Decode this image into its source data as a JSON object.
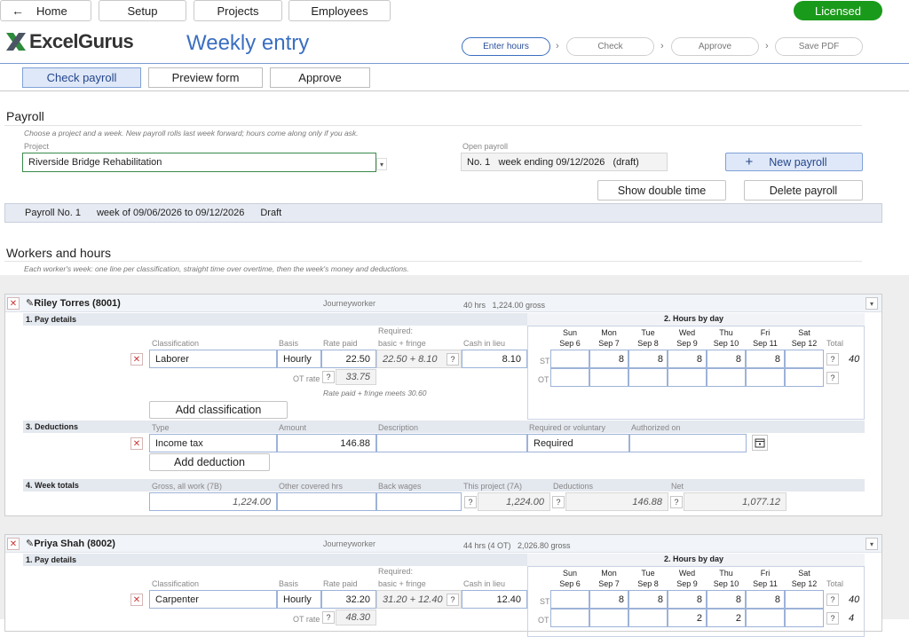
{
  "nav": {
    "home": "Home",
    "setup": "Setup",
    "projects": "Projects",
    "employees": "Employees",
    "license": "Licensed",
    "back_icon": "back-arrow-icon"
  },
  "brand": {
    "logo_text": "ExcelGurus",
    "page_title": "Weekly entry"
  },
  "steps": [
    "Enter hours",
    "Check",
    "Approve",
    "Save PDF"
  ],
  "subtabs": [
    "Check payroll",
    "Preview form",
    "Approve"
  ],
  "payroll": {
    "heading": "Payroll",
    "hint": "Choose a project and a week. New payroll rolls last week forward; hours come along only if you ask.",
    "project_label": "Project",
    "project_value": "Riverside Bridge Rehabilitation",
    "open_label": "Open payroll",
    "open_value": "No. 1   week ending 09/12/2026   (draft)",
    "new_button": "New payroll",
    "show_dt_button": "Show double time",
    "delete_button": "Delete payroll",
    "banner": {
      "number": "Payroll No. 1",
      "range": "week of 09/06/2026 to 09/12/2026",
      "status": "Draft"
    }
  },
  "workers_section": {
    "heading": "Workers and hours",
    "hint": "Each worker's week: one line per classification, straight time over overtime, then the week's money and deductions."
  },
  "labels": {
    "pay_details": "1. Pay details",
    "hours_by_day": "2. Hours by day",
    "deductions": "3. Deductions",
    "week_totals": "4. Week totals",
    "classification": "Classification",
    "basis": "Basis",
    "rate_paid": "Rate paid",
    "required_1": "Required:",
    "required_2": "basic + fringe",
    "cash_in_lieu": "Cash in lieu",
    "total": "Total",
    "st": "ST",
    "ot": "OT",
    "ot_rate": "OT rate",
    "add_classification": "Add classification",
    "add_deduction": "Add deduction",
    "type": "Type",
    "amount": "Amount",
    "description": "Description",
    "req_or_vol": "Required or voluntary",
    "authorized_on": "Authorized on",
    "gross_all": "Gross, all work (7B)",
    "other_hrs": "Other covered hrs",
    "back_wages": "Back wages",
    "this_project": "This project (7A)",
    "deductions_col": "Deductions",
    "net": "Net",
    "q": "?",
    "x": "✕"
  },
  "days": [
    {
      "d": "Sun",
      "date": "Sep 6"
    },
    {
      "d": "Mon",
      "date": "Sep 7"
    },
    {
      "d": "Tue",
      "date": "Sep 8"
    },
    {
      "d": "Wed",
      "date": "Sep 9"
    },
    {
      "d": "Thu",
      "date": "Sep 10"
    },
    {
      "d": "Fri",
      "date": "Sep 11"
    },
    {
      "d": "Sat",
      "date": "Sep 12"
    }
  ],
  "workers": [
    {
      "name": "Riley Torres (8001)",
      "role": "Journeyworker",
      "summary": "40 hrs   1,224.00 gross",
      "classification": "Laborer",
      "basis": "Hourly",
      "rate": "22.50",
      "required": "22.50 + 8.10",
      "cash": "8.10",
      "ot_rate": "33.75",
      "note": "Rate paid + fringe meets 30.60",
      "st": [
        "",
        "8",
        "8",
        "8",
        "8",
        "8",
        ""
      ],
      "ot": [
        "",
        "",
        "",
        "",
        "",
        "",
        ""
      ],
      "st_total": "40",
      "ot_total": "",
      "deduction": {
        "type": "Income tax",
        "amount": "146.88",
        "description": "",
        "required": "Required",
        "authorized": ""
      },
      "totals": {
        "gross": "1,224.00",
        "other": "",
        "back": "",
        "project": "1,224.00",
        "deductions": "146.88",
        "net": "1,077.12"
      }
    },
    {
      "name": "Priya Shah (8002)",
      "role": "Journeyworker",
      "summary": "44 hrs (4 OT)   2,026.80 gross",
      "classification": "Carpenter",
      "basis": "Hourly",
      "rate": "32.20",
      "required": "31.20 + 12.40",
      "cash": "12.40",
      "ot_rate": "48.30",
      "st": [
        "",
        "8",
        "8",
        "8",
        "8",
        "8",
        ""
      ],
      "ot": [
        "",
        "",
        "",
        "2",
        "2",
        "",
        ""
      ],
      "st_total": "40",
      "ot_total": "4"
    }
  ]
}
